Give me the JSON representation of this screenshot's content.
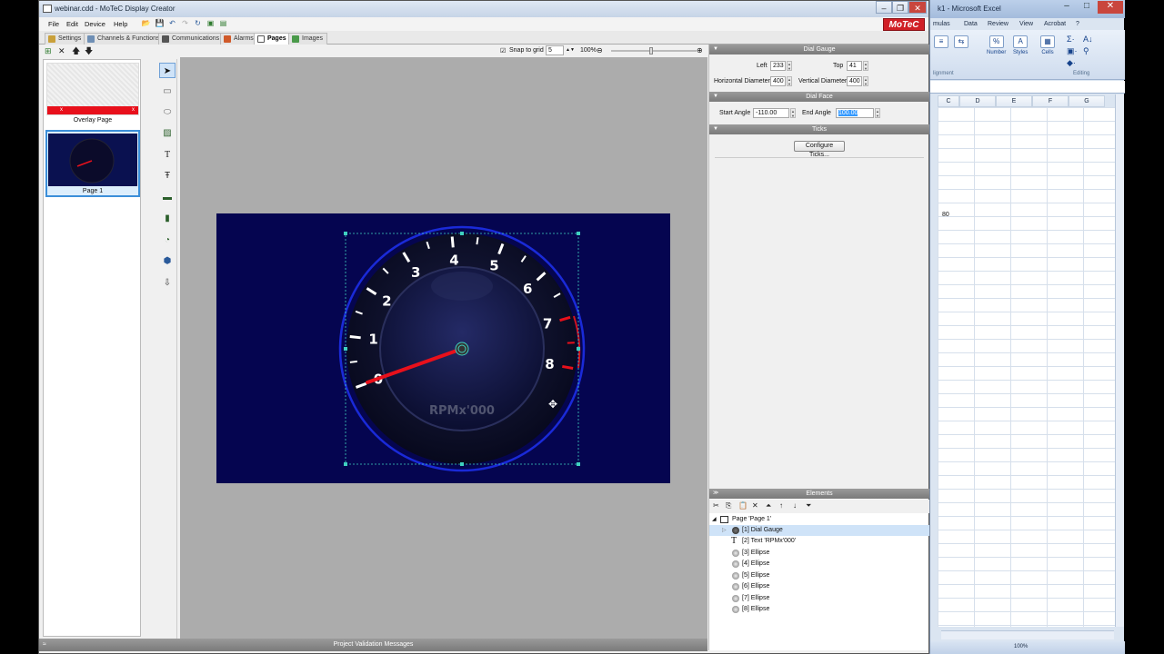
{
  "window": {
    "title": "webinar.cdd - MoTeC Display Creator",
    "logo": "MoTeC"
  },
  "menu": [
    "File",
    "Edit",
    "Device",
    "Help"
  ],
  "tabs": [
    "Settings",
    "Channels & Functions",
    "Communications",
    "Alarms",
    "Pages",
    "Images"
  ],
  "canvas_toolbar": {
    "snap_label": "Snap to grid",
    "snap_value": "5",
    "zoom": "100%"
  },
  "pages": [
    {
      "label": "Overlay Page",
      "bar_left": "x",
      "bar_right": "x"
    },
    {
      "label": "Page 1"
    }
  ],
  "gauge": {
    "labels": [
      "0",
      "1",
      "2",
      "3",
      "4",
      "5",
      "6",
      "7",
      "8"
    ],
    "units_text": "RPMx'000"
  },
  "props": {
    "dial_gauge": {
      "header": "Dial Gauge",
      "left_label": "Left",
      "left": "233",
      "top_label": "Top",
      "top": "41",
      "hdiam_label": "Horizontal Diameter",
      "hdiam": "400",
      "vdiam_label": "Vertical Diameter",
      "vdiam": "400"
    },
    "dial_face": {
      "header": "Dial Face",
      "start_label": "Start Angle",
      "start": "-110.00",
      "end_label": "End Angle",
      "end": "100.00"
    },
    "ticks": {
      "header": "Ticks",
      "button": "Configure Ticks..."
    }
  },
  "elements": {
    "header": "Elements",
    "page": "Page 'Page 1'",
    "items": [
      "[1] Dial Gauge",
      "[2] Text 'RPMx'000'",
      "[3] Ellipse",
      "[4] Ellipse",
      "[5] Ellipse",
      "[6] Ellipse",
      "[7] Ellipse",
      "[8] Ellipse"
    ]
  },
  "validation_bar": "Project Validation Messages",
  "excel": {
    "title": "k1 - Microsoft Excel",
    "menu": [
      "mulas",
      "Data",
      "Review",
      "View",
      "Acrobat"
    ],
    "ribbon": [
      "Number",
      "Styles",
      "Cells"
    ],
    "ribbon_icons": [
      "%",
      "A",
      "▦"
    ],
    "group_labels": [
      "lignment",
      "Editing"
    ],
    "columns": [
      "C",
      "D",
      "E",
      "F",
      "G"
    ],
    "cell_value": "80",
    "zoom": "100%"
  },
  "colors": {
    "display_bg": "#050550",
    "needle": "#e8101b",
    "selection": "#3399ff",
    "motec_red": "#d01f26"
  }
}
